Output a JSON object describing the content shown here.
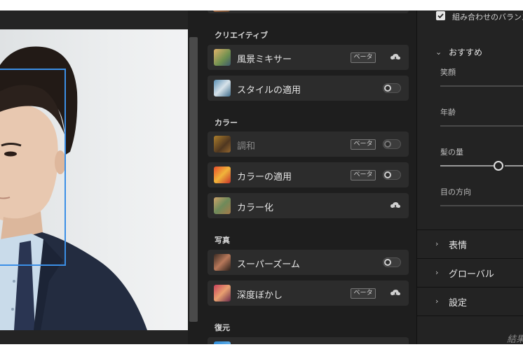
{
  "filters": {
    "sections": [
      {
        "title": "クリエイティブ"
      },
      {
        "title": "カラー"
      },
      {
        "title": "写真"
      },
      {
        "title": "復元"
      }
    ],
    "items": [
      {
        "label": "風景ミキサー",
        "badge": "ベータ",
        "control": "cloud"
      },
      {
        "label": "スタイルの適用",
        "control": "toggle"
      },
      {
        "label": "調和",
        "badge": "ベータ",
        "control": "toggle",
        "disabled": true
      },
      {
        "label": "カラーの適用",
        "badge": "ベータ",
        "control": "toggle"
      },
      {
        "label": "カラー化",
        "control": "cloud"
      },
      {
        "label": "スーパーズーム",
        "control": "toggle"
      },
      {
        "label": "深度ぼかし",
        "badge": "ベータ",
        "control": "cloud"
      }
    ]
  },
  "panel": {
    "combo_label": "組み合わせのバランス",
    "combo_checked": true,
    "recommended": {
      "title": "おすすめ",
      "expanded": true,
      "sliders": [
        {
          "label": "笑顔"
        },
        {
          "label": "年齢"
        },
        {
          "label": "髪の量"
        },
        {
          "label": "目の方向"
        }
      ]
    },
    "groups": [
      {
        "title": "表情",
        "expanded": false
      },
      {
        "title": "グローバル",
        "expanded": false
      },
      {
        "title": "設定",
        "expanded": false
      }
    ],
    "result_text": "結果"
  },
  "colors": {
    "accent_blue": "#3b8fe6",
    "panel_bg": "#1e1e1e",
    "item_bg": "#2c2c2c"
  }
}
